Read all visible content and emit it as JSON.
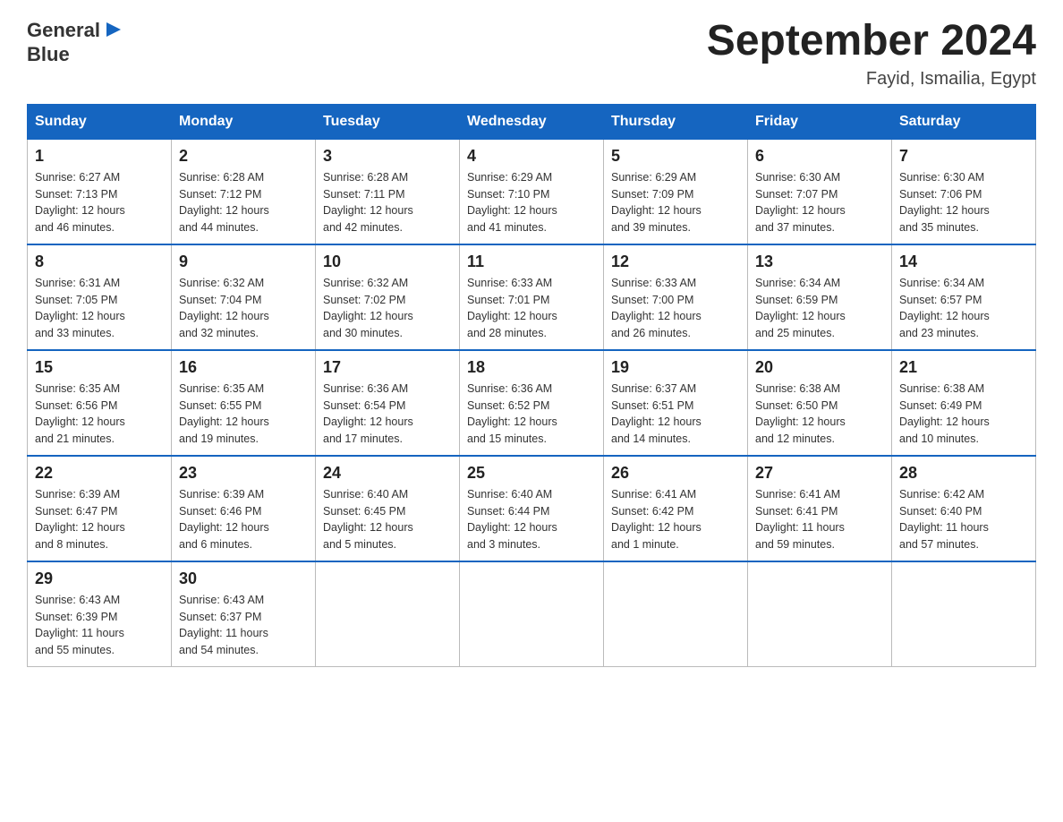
{
  "logo": {
    "text_general": "General",
    "text_blue": "Blue"
  },
  "header": {
    "title": "September 2024",
    "subtitle": "Fayid, Ismailia, Egypt"
  },
  "weekdays": [
    "Sunday",
    "Monday",
    "Tuesday",
    "Wednesday",
    "Thursday",
    "Friday",
    "Saturday"
  ],
  "rows": [
    [
      {
        "day": "1",
        "sunrise": "6:27 AM",
        "sunset": "7:13 PM",
        "daylight": "12 hours and 46 minutes."
      },
      {
        "day": "2",
        "sunrise": "6:28 AM",
        "sunset": "7:12 PM",
        "daylight": "12 hours and 44 minutes."
      },
      {
        "day": "3",
        "sunrise": "6:28 AM",
        "sunset": "7:11 PM",
        "daylight": "12 hours and 42 minutes."
      },
      {
        "day": "4",
        "sunrise": "6:29 AM",
        "sunset": "7:10 PM",
        "daylight": "12 hours and 41 minutes."
      },
      {
        "day": "5",
        "sunrise": "6:29 AM",
        "sunset": "7:09 PM",
        "daylight": "12 hours and 39 minutes."
      },
      {
        "day": "6",
        "sunrise": "6:30 AM",
        "sunset": "7:07 PM",
        "daylight": "12 hours and 37 minutes."
      },
      {
        "day": "7",
        "sunrise": "6:30 AM",
        "sunset": "7:06 PM",
        "daylight": "12 hours and 35 minutes."
      }
    ],
    [
      {
        "day": "8",
        "sunrise": "6:31 AM",
        "sunset": "7:05 PM",
        "daylight": "12 hours and 33 minutes."
      },
      {
        "day": "9",
        "sunrise": "6:32 AM",
        "sunset": "7:04 PM",
        "daylight": "12 hours and 32 minutes."
      },
      {
        "day": "10",
        "sunrise": "6:32 AM",
        "sunset": "7:02 PM",
        "daylight": "12 hours and 30 minutes."
      },
      {
        "day": "11",
        "sunrise": "6:33 AM",
        "sunset": "7:01 PM",
        "daylight": "12 hours and 28 minutes."
      },
      {
        "day": "12",
        "sunrise": "6:33 AM",
        "sunset": "7:00 PM",
        "daylight": "12 hours and 26 minutes."
      },
      {
        "day": "13",
        "sunrise": "6:34 AM",
        "sunset": "6:59 PM",
        "daylight": "12 hours and 25 minutes."
      },
      {
        "day": "14",
        "sunrise": "6:34 AM",
        "sunset": "6:57 PM",
        "daylight": "12 hours and 23 minutes."
      }
    ],
    [
      {
        "day": "15",
        "sunrise": "6:35 AM",
        "sunset": "6:56 PM",
        "daylight": "12 hours and 21 minutes."
      },
      {
        "day": "16",
        "sunrise": "6:35 AM",
        "sunset": "6:55 PM",
        "daylight": "12 hours and 19 minutes."
      },
      {
        "day": "17",
        "sunrise": "6:36 AM",
        "sunset": "6:54 PM",
        "daylight": "12 hours and 17 minutes."
      },
      {
        "day": "18",
        "sunrise": "6:36 AM",
        "sunset": "6:52 PM",
        "daylight": "12 hours and 15 minutes."
      },
      {
        "day": "19",
        "sunrise": "6:37 AM",
        "sunset": "6:51 PM",
        "daylight": "12 hours and 14 minutes."
      },
      {
        "day": "20",
        "sunrise": "6:38 AM",
        "sunset": "6:50 PM",
        "daylight": "12 hours and 12 minutes."
      },
      {
        "day": "21",
        "sunrise": "6:38 AM",
        "sunset": "6:49 PM",
        "daylight": "12 hours and 10 minutes."
      }
    ],
    [
      {
        "day": "22",
        "sunrise": "6:39 AM",
        "sunset": "6:47 PM",
        "daylight": "12 hours and 8 minutes."
      },
      {
        "day": "23",
        "sunrise": "6:39 AM",
        "sunset": "6:46 PM",
        "daylight": "12 hours and 6 minutes."
      },
      {
        "day": "24",
        "sunrise": "6:40 AM",
        "sunset": "6:45 PM",
        "daylight": "12 hours and 5 minutes."
      },
      {
        "day": "25",
        "sunrise": "6:40 AM",
        "sunset": "6:44 PM",
        "daylight": "12 hours and 3 minutes."
      },
      {
        "day": "26",
        "sunrise": "6:41 AM",
        "sunset": "6:42 PM",
        "daylight": "12 hours and 1 minute."
      },
      {
        "day": "27",
        "sunrise": "6:41 AM",
        "sunset": "6:41 PM",
        "daylight": "11 hours and 59 minutes."
      },
      {
        "day": "28",
        "sunrise": "6:42 AM",
        "sunset": "6:40 PM",
        "daylight": "11 hours and 57 minutes."
      }
    ],
    [
      {
        "day": "29",
        "sunrise": "6:43 AM",
        "sunset": "6:39 PM",
        "daylight": "11 hours and 55 minutes."
      },
      {
        "day": "30",
        "sunrise": "6:43 AM",
        "sunset": "6:37 PM",
        "daylight": "11 hours and 54 minutes."
      },
      null,
      null,
      null,
      null,
      null
    ]
  ],
  "labels": {
    "sunrise": "Sunrise:",
    "sunset": "Sunset:",
    "daylight": "Daylight:"
  }
}
